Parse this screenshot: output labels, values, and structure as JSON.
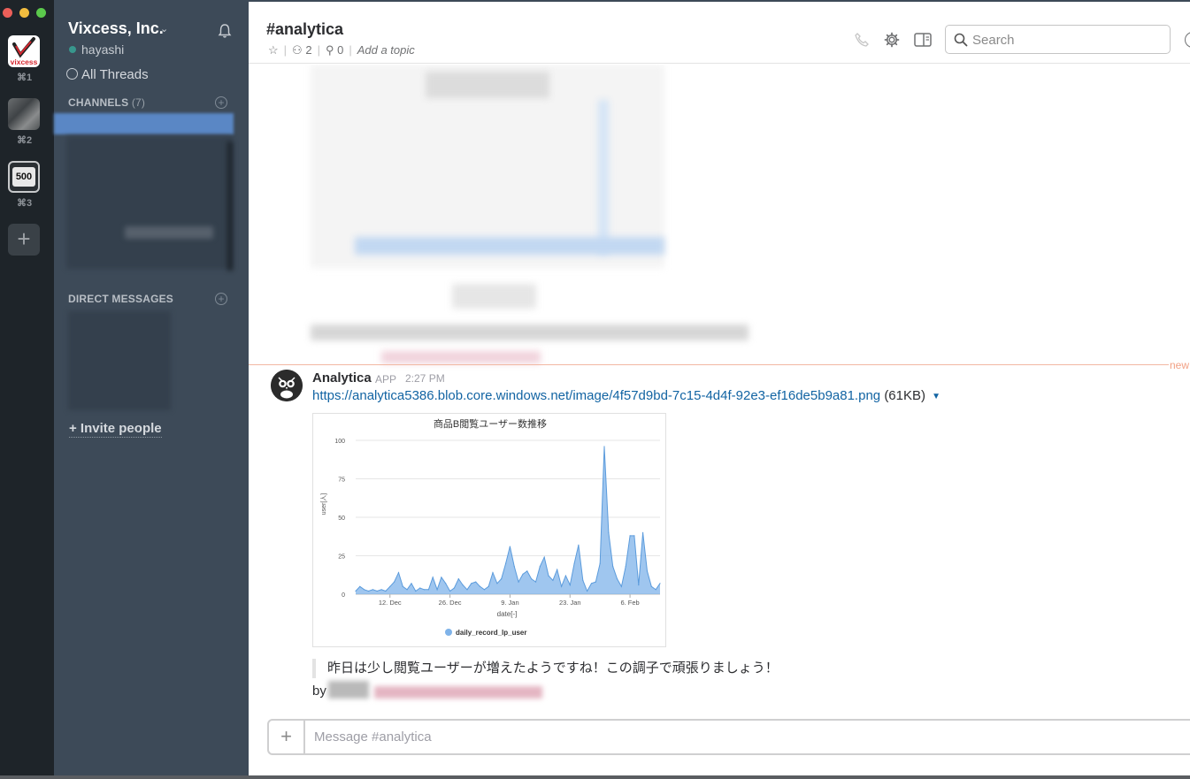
{
  "workspaces": [
    {
      "name": "vixcess",
      "logo_text": "vixcess",
      "shortcut": "⌘1"
    },
    {
      "name": "workspace-2",
      "shortcut": "⌘2"
    },
    {
      "name": "workspace-3",
      "logo_text": "500",
      "shortcut": "⌘3"
    }
  ],
  "sidebar": {
    "team_name": "Vixcess, Inc.",
    "username": "hayashi",
    "all_threads": "All Threads",
    "channels_label": "CHANNELS",
    "channels_count": "(7)",
    "dm_label": "DIRECT MESSAGES",
    "invite": "+ Invite people"
  },
  "header": {
    "channel": "#analytica",
    "members": "2",
    "pins": "0",
    "topic": "Add a topic",
    "search_placeholder": "Search"
  },
  "message": {
    "sender": "Analytica",
    "badge": "APP",
    "time": "2:27 PM",
    "link": "https://analytica5386.blob.core.windows.net/image/4f57d9bd-7c15-4d4f-92e3-ef16de5b9a81.png",
    "size": "(61KB)",
    "quote": "昨日は少し閲覧ユーザーが増えたようですね！この調子で頑張りましょう！",
    "by": "by",
    "new_label": "new"
  },
  "composer": {
    "placeholder": "Message #analytica"
  },
  "colors": {
    "rail": "#1e2429",
    "sidebar": "#3d4a58",
    "link": "#1264a3",
    "series": "#7fb3e9",
    "new_line": "#f2b8a3"
  },
  "chart_data": {
    "type": "area",
    "title": "商品B閲覧ユーザー数推移",
    "xlabel": "date[-]",
    "ylabel": "user[人]",
    "ylim": [
      0,
      100
    ],
    "yticks": [
      0,
      25,
      50,
      75,
      100
    ],
    "xticks": [
      "12. Dec",
      "26. Dec",
      "9. Jan",
      "23. Jan",
      "6. Feb"
    ],
    "xlim": [
      "2017-12-04",
      "2018-02-13"
    ],
    "grid": true,
    "legend": "bottom-center",
    "series": [
      {
        "name": "daily_record_lp_user",
        "color": "#7fb3e9",
        "x": [
          "2017-12-04",
          "2017-12-05",
          "2017-12-06",
          "2017-12-07",
          "2017-12-08",
          "2017-12-09",
          "2017-12-10",
          "2017-12-11",
          "2017-12-12",
          "2017-12-13",
          "2017-12-14",
          "2017-12-15",
          "2017-12-16",
          "2017-12-17",
          "2017-12-18",
          "2017-12-19",
          "2017-12-20",
          "2017-12-21",
          "2017-12-22",
          "2017-12-23",
          "2017-12-24",
          "2017-12-25",
          "2017-12-26",
          "2017-12-27",
          "2017-12-28",
          "2017-12-29",
          "2017-12-30",
          "2017-12-31",
          "2018-01-01",
          "2018-01-02",
          "2018-01-03",
          "2018-01-04",
          "2018-01-05",
          "2018-01-06",
          "2018-01-07",
          "2018-01-08",
          "2018-01-09",
          "2018-01-10",
          "2018-01-11",
          "2018-01-12",
          "2018-01-13",
          "2018-01-14",
          "2018-01-15",
          "2018-01-16",
          "2018-01-17",
          "2018-01-18",
          "2018-01-19",
          "2018-01-20",
          "2018-01-21",
          "2018-01-22",
          "2018-01-23",
          "2018-01-24",
          "2018-01-25",
          "2018-01-26",
          "2018-01-27",
          "2018-01-28",
          "2018-01-29",
          "2018-01-30",
          "2018-01-31",
          "2018-02-01",
          "2018-02-02",
          "2018-02-03",
          "2018-02-04",
          "2018-02-05",
          "2018-02-06",
          "2018-02-07",
          "2018-02-08",
          "2018-02-09",
          "2018-02-10",
          "2018-02-11",
          "2018-02-12",
          "2018-02-13"
        ],
        "values": [
          2,
          5,
          3,
          2,
          3,
          2,
          3,
          2,
          5,
          8,
          14,
          5,
          3,
          7,
          2,
          4,
          3,
          3,
          11,
          3,
          11,
          7,
          2,
          4,
          10,
          6,
          3,
          7,
          8,
          5,
          3,
          5,
          14,
          7,
          10,
          20,
          31,
          18,
          8,
          13,
          15,
          10,
          8,
          18,
          24,
          12,
          9,
          16,
          5,
          12,
          6,
          20,
          32,
          9,
          2,
          7,
          8,
          20,
          96,
          40,
          18,
          10,
          5,
          18,
          38,
          38,
          6,
          40,
          15,
          5,
          3,
          7
        ]
      }
    ]
  }
}
